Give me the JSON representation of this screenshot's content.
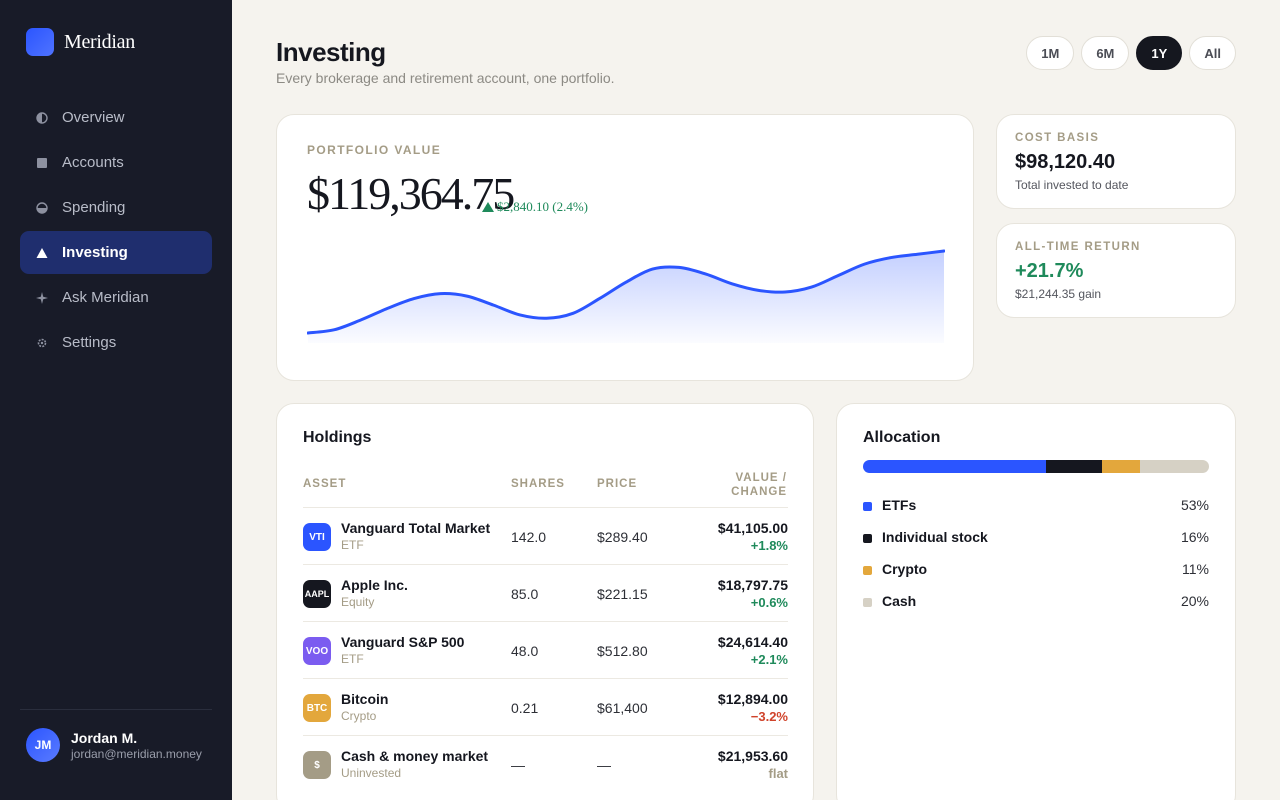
{
  "app": {
    "name": "Meridian"
  },
  "sidebar": {
    "items": [
      {
        "label": "Overview",
        "icon": "overview-icon",
        "active": false
      },
      {
        "label": "Accounts",
        "icon": "accounts-icon",
        "active": false
      },
      {
        "label": "Spending",
        "icon": "spending-icon",
        "active": false
      },
      {
        "label": "Investing",
        "icon": "investing-icon",
        "active": true
      },
      {
        "label": "Ask Meridian",
        "icon": "sparkle-icon",
        "active": false
      },
      {
        "label": "Settings",
        "icon": "gear-icon",
        "active": false
      }
    ],
    "user": {
      "initials": "JM",
      "name": "Jordan M.",
      "email": "jordan@meridian.money"
    }
  },
  "header": {
    "title": "Investing",
    "subtitle": "Every brokerage and retirement account, one portfolio.",
    "ranges": [
      "1M",
      "6M",
      "1Y",
      "All"
    ],
    "active_range": "1Y"
  },
  "portfolio": {
    "label": "PORTFOLIO VALUE",
    "value": "$119,364.75",
    "change": "$2,840.10 (2.4%)"
  },
  "stats": {
    "cost_basis": {
      "label": "COST BASIS",
      "value": "$98,120.40",
      "sub": "Total invested to date"
    },
    "return": {
      "label": "ALL-TIME RETURN",
      "value": "+21.7%",
      "sub": "$21,244.35 gain"
    }
  },
  "holdings": {
    "title": "Holdings",
    "columns": {
      "asset": "ASSET",
      "shares": "SHARES",
      "price": "PRICE",
      "value_1": "VALUE /",
      "value_2": "CHANGE"
    },
    "rows": [
      {
        "ticker": "VTI",
        "color": "#2b55ff",
        "name": "Vanguard Total Market",
        "type": "ETF",
        "shares": "142.0",
        "price": "$289.40",
        "value": "$41,105.00",
        "change": "+1.8%",
        "trend": "pos"
      },
      {
        "ticker": "AAPL",
        "color": "#15171f",
        "name": "Apple Inc.",
        "type": "Equity",
        "shares": "85.0",
        "price": "$221.15",
        "value": "$18,797.75",
        "change": "+0.6%",
        "trend": "pos"
      },
      {
        "ticker": "VOO",
        "color": "#7b5cf0",
        "name": "Vanguard S&P 500",
        "type": "ETF",
        "shares": "48.0",
        "price": "$512.80",
        "value": "$24,614.40",
        "change": "+2.1%",
        "trend": "pos"
      },
      {
        "ticker": "BTC",
        "color": "#e3a73c",
        "name": "Bitcoin",
        "type": "Crypto",
        "shares": "0.21",
        "price": "$61,400",
        "value": "$12,894.00",
        "change": "−3.2%",
        "trend": "neg"
      },
      {
        "ticker": "$",
        "color": "#a49c86",
        "name": "Cash & money market",
        "type": "Uninvested",
        "shares": "—",
        "price": "—",
        "value": "$21,953.60",
        "change": "flat",
        "trend": "flat"
      }
    ]
  },
  "allocation": {
    "title": "Allocation",
    "items": [
      {
        "label": "ETFs",
        "pct": "53%",
        "share": 53,
        "color": "#2b55ff"
      },
      {
        "label": "Individual stock",
        "pct": "16%",
        "share": 16,
        "color": "#15171f"
      },
      {
        "label": "Crypto",
        "pct": "11%",
        "share": 11,
        "color": "#e3a73c"
      },
      {
        "label": "Cash",
        "pct": "20%",
        "share": 20,
        "color": "#d6d1c5"
      }
    ]
  },
  "chart_data": {
    "type": "area",
    "title": "",
    "xlabel": "",
    "ylabel": "",
    "series": [
      {
        "values": [
          0.0,
          0.04,
          0.16,
          0.3,
          0.42,
          0.48,
          0.45,
          0.34,
          0.22,
          0.18,
          0.24,
          0.42,
          0.62,
          0.78,
          0.8,
          0.72,
          0.6,
          0.52,
          0.5,
          0.56,
          0.7,
          0.84,
          0.92,
          0.96,
          1.0
        ]
      }
    ],
    "color": "#2b55ff",
    "grid": false
  }
}
